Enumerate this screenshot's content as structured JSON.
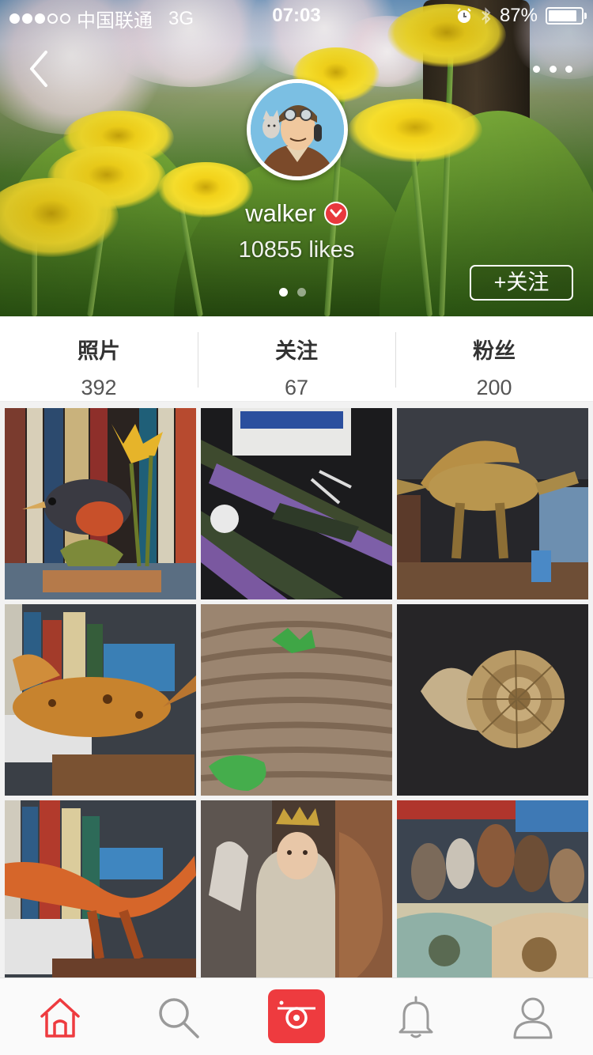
{
  "status_bar": {
    "carrier": "中国联通",
    "network": "3G",
    "time": "07:03",
    "battery": "87%",
    "battery_level": 0.87,
    "signal_dots_filled": 3,
    "signal_dots_total": 5
  },
  "profile": {
    "username": "walker",
    "likes": "10855 likes",
    "follow_button": "+关注",
    "page_count": 2,
    "current_page": 1
  },
  "stats": [
    {
      "label": "照片",
      "value": "392"
    },
    {
      "label": "关注",
      "value": "67"
    },
    {
      "label": "粉丝",
      "value": "200"
    }
  ],
  "tabs": [
    "home-icon",
    "search-icon",
    "camera-icon",
    "bell-icon",
    "user-icon"
  ],
  "colors": {
    "accent": "#ee3b3f",
    "tab_inactive": "#9a9a9a",
    "text_primary": "#333333"
  }
}
